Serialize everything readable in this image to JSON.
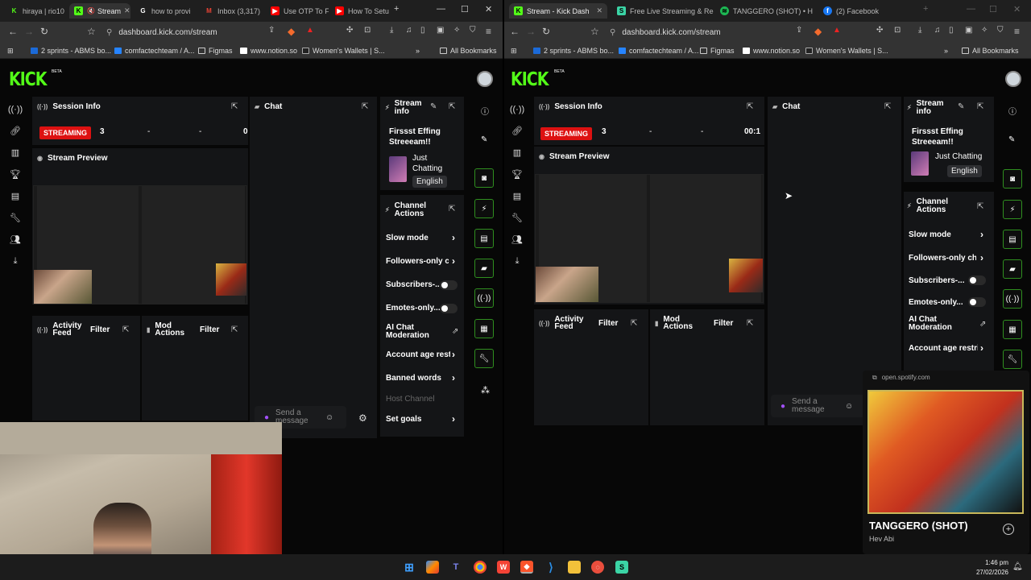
{
  "left_window": {
    "tabs": [
      {
        "label": "hiraya | rio10",
        "icon": "kick-icon",
        "active": false
      },
      {
        "label": "Stream",
        "icon": "kick-icon",
        "active": true
      },
      {
        "label": "how to provi",
        "icon": "google-icon",
        "active": false
      },
      {
        "label": "Inbox (3,317)",
        "icon": "gmail-icon",
        "active": false
      },
      {
        "label": "Use OTP To F",
        "icon": "youtube-icon",
        "active": false
      },
      {
        "label": "How To Setu",
        "icon": "youtube-icon",
        "active": false
      }
    ],
    "url": "dashboard.kick.com/stream",
    "bookmarks": [
      "2 sprints - ABMS bo...",
      "comfactechteam / A...",
      "Figmas",
      "www.notion.so",
      "Women's Wallets | S..."
    ],
    "all_bookmarks": "All Bookmarks",
    "logo": "KICK",
    "beta": "BETA",
    "session_info": {
      "title": "Session Info",
      "status": "STREAMING",
      "viewers": "3",
      "stat2": "-",
      "stat3": "-",
      "stat4": "0"
    },
    "stream_preview": {
      "title": "Stream Preview"
    },
    "activity_feed": {
      "title": "Activity Feed",
      "filter": "Filter"
    },
    "mod_actions": {
      "title": "Mod Actions",
      "filter": "Filter"
    },
    "chat": {
      "title": "Chat",
      "placeholder": "Send a message"
    },
    "stream_info": {
      "title": "Stream info",
      "stream_title": "Firssst Effing Streeeam!!",
      "category": "Just Chatting",
      "language": "English"
    },
    "channel_actions": {
      "title": "Channel Actions",
      "slow_mode": "Slow mode",
      "followers_only": "Followers-only cl",
      "subscribers": "Subscribers-...",
      "emotes_only": "Emotes-only...",
      "ai_moderation": "AI Chat Moderation",
      "account_age": "Account age rest",
      "banned_words": "Banned words",
      "host_channel": "Host Channel",
      "set_goals": "Set goals"
    }
  },
  "right_window": {
    "tabs": [
      {
        "label": "Stream - Kick Dash",
        "icon": "kick-icon",
        "active": true
      },
      {
        "label": "Free Live Streaming & Rec",
        "icon": "streamyard-icon",
        "active": false
      },
      {
        "label": "TANGGERO (SHOT) • H",
        "icon": "spotify-icon",
        "active": false
      },
      {
        "label": "(2) Facebook",
        "icon": "facebook-icon",
        "active": false
      }
    ],
    "url": "dashboard.kick.com/stream",
    "bookmarks": [
      "2 sprints - ABMS bo...",
      "comfactechteam / A...",
      "Figmas",
      "www.notion.so",
      "Women's Wallets | S..."
    ],
    "all_bookmarks": "All Bookmarks",
    "logo": "KICK",
    "beta": "BETA",
    "session_info": {
      "title": "Session Info",
      "status": "STREAMING",
      "viewers": "3",
      "stat2": "-",
      "stat3": "-",
      "stat4": "00:1"
    },
    "stream_preview": {
      "title": "Stream Preview"
    },
    "activity_feed": {
      "title": "Activity Feed",
      "filter": "Filter"
    },
    "mod_actions": {
      "title": "Mod Actions",
      "filter": "Filter"
    },
    "chat": {
      "title": "Chat",
      "placeholder": "Send a message"
    },
    "stream_info": {
      "title": "Stream info",
      "stream_title": "Firssst Effing Streeeam!!",
      "category": "Just Chatting",
      "language": "English"
    },
    "channel_actions": {
      "title": "Channel Actions",
      "slow_mode": "Slow mode",
      "followers_only": "Followers-only cha",
      "subscribers": "Subscribers-...",
      "emotes_only": "Emotes-only...",
      "ai_moderation": "AI Chat Moderation",
      "account_age": "Account age restri"
    }
  },
  "spotify_popup": {
    "source": "open.spotify.com",
    "track": "TANGGERO (SHOT)",
    "artist": "Hev Abi"
  },
  "taskbar": {
    "time": "1:46 pm",
    "date": "27/02/2026"
  },
  "colors": {
    "kick_green": "#53fc18",
    "streaming_red": "#dd1111"
  }
}
